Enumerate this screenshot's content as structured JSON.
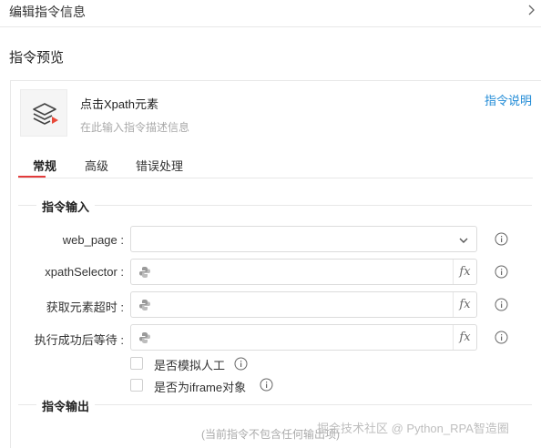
{
  "header": {
    "title": "编辑指令信息",
    "close_icon": "chevron-right-icon"
  },
  "preview": {
    "title": "指令预览"
  },
  "command": {
    "icon": "layers-play-icon",
    "name": "点击Xpath元素",
    "description_placeholder": "在此输入指令描述信息",
    "help_link": "指令说明"
  },
  "tabs": [
    {
      "label": "常规",
      "active": true
    },
    {
      "label": "高级",
      "active": false
    },
    {
      "label": "错误处理",
      "active": false
    }
  ],
  "colors": {
    "accent_tab": "#e33b3b",
    "link": "#1f8ad6"
  },
  "input_group": {
    "title": "指令输入",
    "fields": [
      {
        "label": "web_page :",
        "type": "select",
        "value": ""
      },
      {
        "label": "xpathSelector :",
        "type": "python-expr",
        "value": "",
        "fx_label": "fx"
      },
      {
        "label": "获取元素超时 :",
        "type": "python-expr",
        "value": "",
        "fx_label": "fx"
      },
      {
        "label": "执行成功后等待 :",
        "type": "python-expr",
        "value": "",
        "fx_label": "fx"
      }
    ],
    "checkboxes": [
      {
        "label": "是否模拟人工",
        "checked": false
      },
      {
        "label": "是否为iframe对象",
        "checked": false
      }
    ]
  },
  "output_group": {
    "title": "指令输出",
    "note": "(当前指令不包含任何输出项)"
  },
  "watermark": "掘金技术社区 @ Python_RPA智造圈"
}
